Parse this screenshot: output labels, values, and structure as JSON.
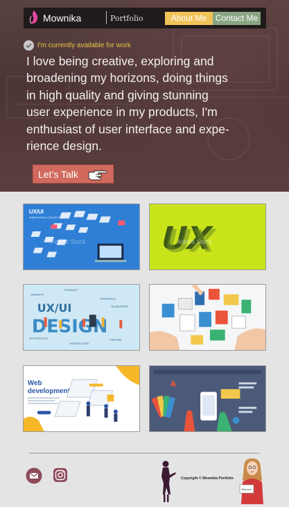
{
  "navbar": {
    "brand_name": "Mownika",
    "brand_sub": "Portfolio",
    "about_label": "About Me",
    "contact_label": "Contact Me"
  },
  "hero": {
    "availability": "I'm currently available for work",
    "headline_lines": [
      "I love being creative, exploring and",
      "broadening my horizons, doing things",
      "in high quality and giving stunning",
      "user experience in my products, I'm",
      "enthusiast of user interface and expe-",
      "rience design."
    ],
    "cta_label": "Let’s Talk"
  },
  "gallery": [
    {
      "name": "wireframe-concept-image",
      "caption_1": "UX/UI",
      "caption_2": "WIREFRAME CONCEPT",
      "watermark": "Adobe Stock"
    },
    {
      "name": "ux-3d-letters-image",
      "caption_1": "UX",
      "watermark": "Adobe Stock"
    },
    {
      "name": "ux-ui-design-image",
      "caption_1": "UX/UI",
      "caption_2": "DESIGN",
      "tags": [
        "USABILITY",
        "PRODUCT",
        "INTERFACE",
        "DEVELOPER",
        "TECHNOLOGY",
        "INTERACTION",
        "TESTING"
      ]
    },
    {
      "name": "design-cards-image"
    },
    {
      "name": "web-development-image",
      "caption_1": "Web",
      "caption_2": "development"
    },
    {
      "name": "design-tools-image"
    }
  ],
  "footer": {
    "copyright": "Copyright © Mownika Portfolio",
    "sign_text": "Welcome"
  },
  "colors": {
    "about_btn": "#f0c35a",
    "contact_btn": "#8aa582",
    "cta": "#d1695d",
    "availability_text": "#e6c848",
    "brand_icon": "#e0479e"
  }
}
